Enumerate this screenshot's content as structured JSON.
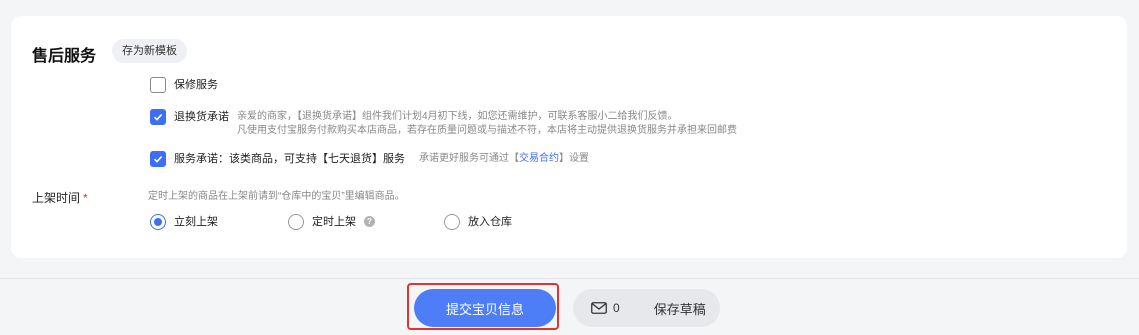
{
  "section": {
    "title": "售后服务",
    "template_button": "存为新模板"
  },
  "services": [
    {
      "label": "保修服务",
      "checked": false
    },
    {
      "label": "退换货承诺",
      "checked": true,
      "hint_line1": "亲爱的商家，【退换货承诺】组件我们计划4月初下线，如您还需维护，可联系客服小二给我们反馈。",
      "hint_line2": "凡使用支付宝服务付款购买本店商品，若存在质量问题或与描述不符，本店将主动提供退换货服务并承担来回邮费"
    },
    {
      "label": "服务承诺：该类商品，可支持【七天退货】服务",
      "checked": true,
      "hint_prefix": "承诺更好服务可通过【",
      "hint_link": "交易合约",
      "hint_suffix": "】设置"
    }
  ],
  "listing": {
    "label": "上架时间",
    "required_mark": "*",
    "hint": "定时上架的商品在上架前请到“仓库中的宝贝”里编辑商品。",
    "options": [
      {
        "label": "立刻上架",
        "selected": true
      },
      {
        "label": "定时上架",
        "selected": false,
        "help": "?"
      },
      {
        "label": "放入仓库",
        "selected": false
      }
    ]
  },
  "footer": {
    "submit_label": "提交宝贝信息",
    "draft_count": "0",
    "draft_label": "保存草稿"
  },
  "colors": {
    "accent": "#3d6ef5",
    "submit": "#4d7ef7",
    "highlight_border": "#e0352f",
    "required": "#e0312a"
  }
}
